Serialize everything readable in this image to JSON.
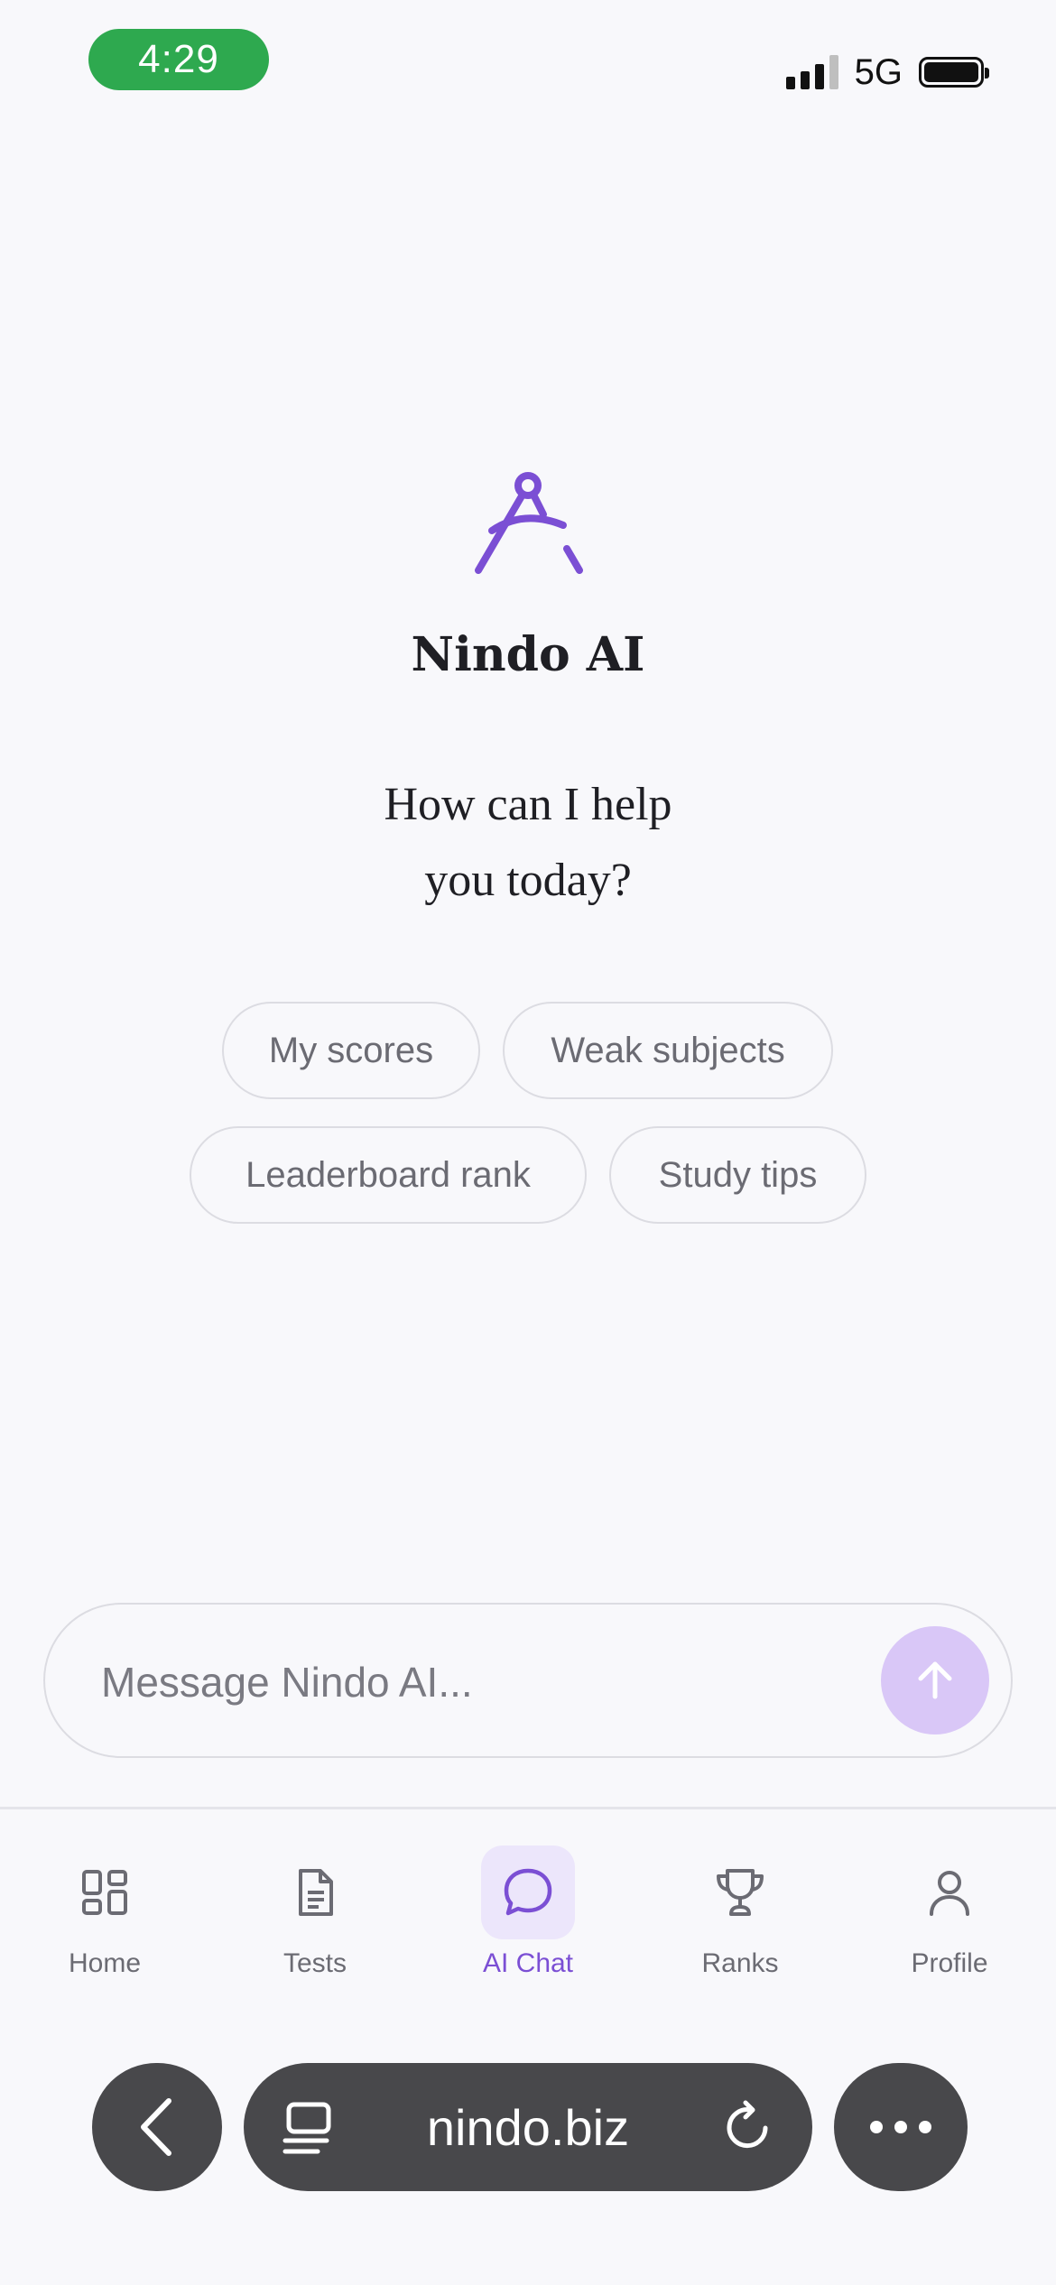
{
  "status_bar": {
    "time": "4:29",
    "network": "5G"
  },
  "hero": {
    "app_name": "Nindo AI",
    "greeting": "How can I help you today?"
  },
  "suggestions": [
    "My scores",
    "Weak subjects",
    "Leaderboard rank",
    "Study tips"
  ],
  "composer": {
    "placeholder": "Message Nindo AI..."
  },
  "tabs": [
    {
      "label": "Home",
      "icon": "grid-icon"
    },
    {
      "label": "Tests",
      "icon": "document-icon"
    },
    {
      "label": "AI Chat",
      "icon": "chat-bubble-icon",
      "active": true
    },
    {
      "label": "Ranks",
      "icon": "trophy-icon"
    },
    {
      "label": "Profile",
      "icon": "person-icon"
    }
  ],
  "browser": {
    "url": "nindo.biz"
  },
  "colors": {
    "accent": "#7b4fd4",
    "send_button": "#d9c7f7",
    "status_time_bg": "#2ea94f"
  }
}
